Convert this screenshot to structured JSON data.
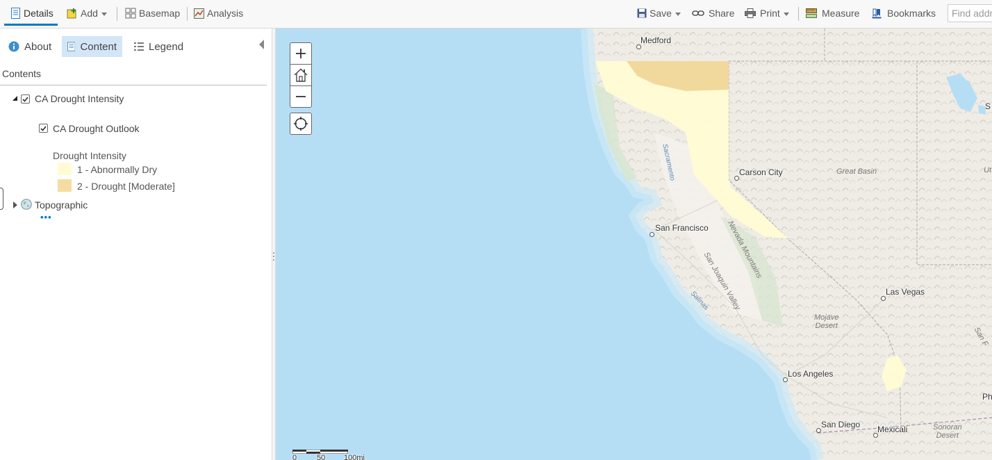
{
  "toolbar": {
    "details": "Details",
    "add": "Add",
    "basemap": "Basemap",
    "analysis": "Analysis",
    "save": "Save",
    "share": "Share",
    "print": "Print",
    "measure": "Measure",
    "bookmarks": "Bookmarks",
    "search_placeholder": "Find address or place"
  },
  "sidebar": {
    "tabs": {
      "about": "About",
      "content": "Content",
      "legend": "Legend"
    },
    "active_tab": "Content",
    "contents_heading": "Contents",
    "layers": [
      {
        "label": "CA Drought Intensity",
        "checked": true,
        "expanded": true
      },
      {
        "label": "CA Drought Outlook",
        "checked": true
      },
      {
        "label": "Topographic",
        "expanded": false
      }
    ],
    "legend_title": "Drought Intensity",
    "legend": [
      {
        "label": "1 - Abnormally Dry",
        "color": "#fffcd4"
      },
      {
        "label": "2 - Drought [Moderate]",
        "color": "#f5dca0"
      }
    ],
    "more": "•••"
  },
  "map": {
    "colors": {
      "ocean": "#b5def5",
      "land": "#f1efea",
      "abnormally_dry": "#fffcd4",
      "moderate_drought": "#f1d89c"
    },
    "cities": [
      {
        "name": "Medford"
      },
      {
        "name": "Carson City"
      },
      {
        "name": "San Francisco"
      },
      {
        "name": "Las Vegas"
      },
      {
        "name": "Los Angeles"
      },
      {
        "name": "San Diego"
      },
      {
        "name": "Mexicali"
      }
    ],
    "regions": {
      "great_basin": "Great Basin",
      "sierra_nevada": "Nevada Mountains",
      "san_joaquin": "San Joaquin Valley",
      "mojave_1": "Mojave",
      "mojave_2": "Desert",
      "sonoran_1": "Sonoran",
      "sonoran_2": "Desert",
      "sacramento": "Sacramento",
      "salinas": "Salinas"
    },
    "edge_labels": {
      "ut": "Ut",
      "s": "S",
      "san_f": "San F",
      "ph": "Ph"
    },
    "scale_labels": [
      "0",
      "50",
      "100mi"
    ]
  }
}
